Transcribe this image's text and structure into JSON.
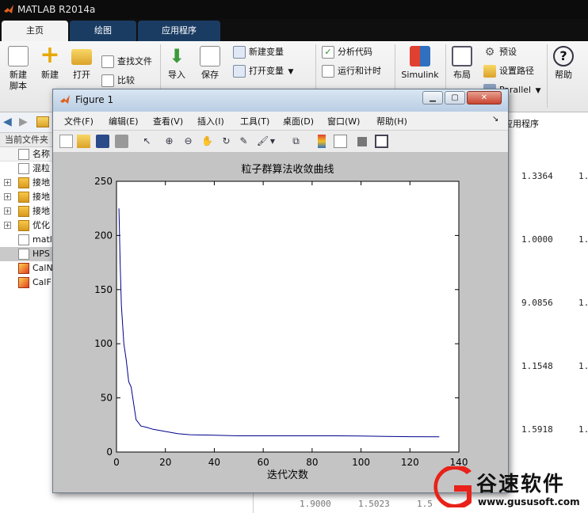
{
  "window": {
    "title": "MATLAB R2014a"
  },
  "tabs": [
    {
      "label": "主页"
    },
    {
      "label": "绘图"
    },
    {
      "label": "应用程序"
    }
  ],
  "ribbon": {
    "new_script": "新建\n脚本",
    "new": "新建",
    "open": "打开",
    "find_files": "查找文件",
    "compare": "比较",
    "import": "导入",
    "save": "保存",
    "new_variable": "新建变量",
    "open_variable": "打开变量",
    "analyze_code": "分析代码",
    "run_and_time": "运行和计时",
    "simulink": "Simulink",
    "layout": "布局",
    "preferences": "预设",
    "set_path": "设置路径",
    "parallel": "Parallel",
    "help": "帮助"
  },
  "left_panel": {
    "header": "当前文件夹",
    "name_column": "名称",
    "items": [
      {
        "label": "混粒",
        "type": "file",
        "expand": ""
      },
      {
        "label": "接地",
        "type": "folder",
        "expand": "+"
      },
      {
        "label": "接地",
        "type": "folder",
        "expand": "+"
      },
      {
        "label": "接地",
        "type": "folder",
        "expand": "+"
      },
      {
        "label": "优化",
        "type": "folder",
        "expand": "+"
      },
      {
        "label": "matl",
        "type": "file",
        "expand": ""
      },
      {
        "label": "HPS",
        "type": "file",
        "expand": "",
        "selected": true
      },
      {
        "label": "CalN",
        "type": "img",
        "expand": ""
      },
      {
        "label": "CalF",
        "type": "img",
        "expand": ""
      }
    ]
  },
  "right_panel": {
    "title": "应用程序",
    "values": [
      "1.3364",
      "1.0000",
      "9.0856",
      "1.1548",
      "1.5918"
    ],
    "col2": "1.",
    "bottom_row": [
      "1.9000",
      "1.5023",
      "1.5"
    ]
  },
  "figure": {
    "title": "Figure 1",
    "menu": [
      "文件(F)",
      "编辑(E)",
      "查看(V)",
      "插入(I)",
      "工具(T)",
      "桌面(D)",
      "窗口(W)",
      "帮助(H)"
    ]
  },
  "chart_data": {
    "type": "line",
    "title": "粒子群算法收敛曲线",
    "xlabel": "迭代次数",
    "ylabel": "",
    "xlim": [
      0,
      140
    ],
    "ylim": [
      0,
      250
    ],
    "xticks": [
      0,
      20,
      40,
      60,
      80,
      100,
      120,
      140
    ],
    "yticks": [
      0,
      50,
      100,
      150,
      200,
      250
    ],
    "grid": false,
    "color": "#00008b",
    "x": [
      1,
      1.5,
      2,
      3,
      4,
      5,
      6,
      7,
      8,
      10,
      12,
      15,
      20,
      25,
      30,
      40,
      50,
      60,
      70,
      80,
      90,
      100,
      110,
      120,
      132
    ],
    "values": [
      225,
      175,
      135,
      100,
      85,
      65,
      60,
      45,
      30,
      24,
      23,
      21,
      19,
      17,
      16,
      15.5,
      15,
      15,
      15,
      15,
      15,
      14.8,
      14.5,
      14.2,
      14
    ]
  },
  "watermark": {
    "text": "谷速软件",
    "url": "www.gususoft.com"
  }
}
